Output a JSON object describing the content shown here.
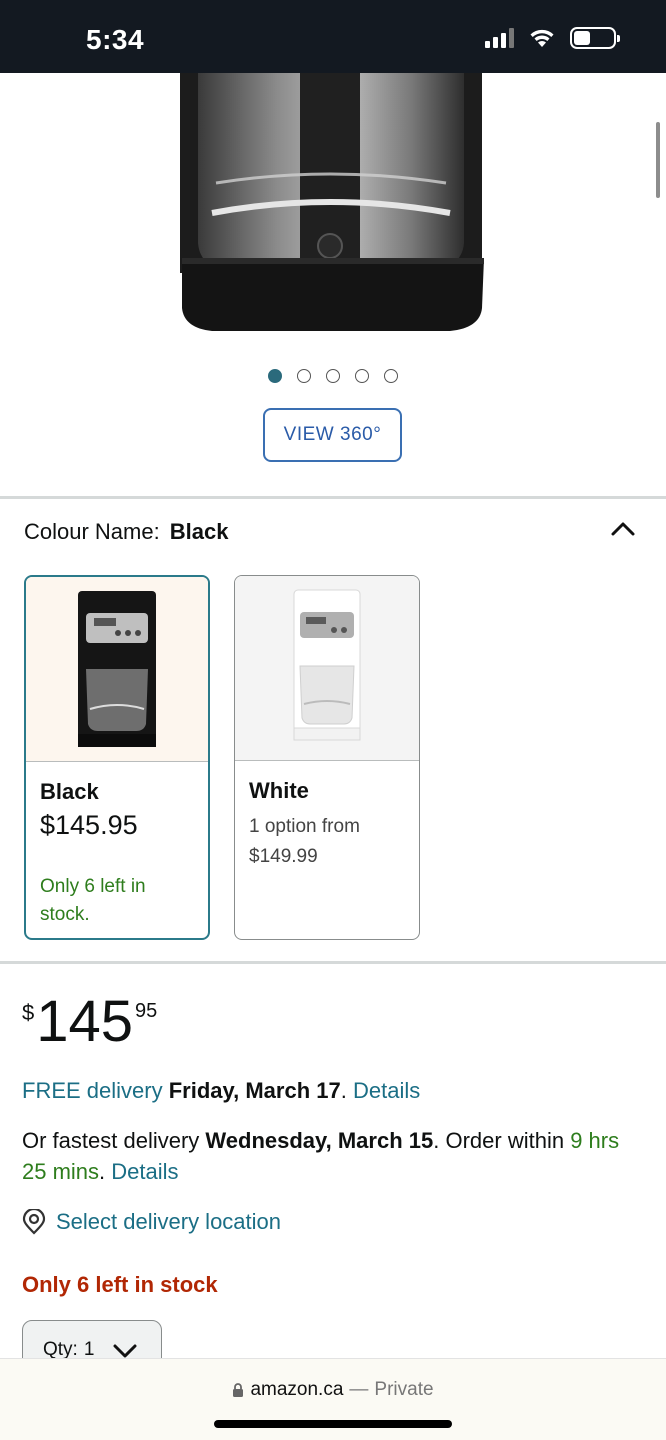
{
  "status_bar": {
    "time": "5:34"
  },
  "carousel": {
    "total_images": 5,
    "active_index": 0
  },
  "view360": {
    "label": "VIEW 360°"
  },
  "colour": {
    "label": "Colour Name:",
    "selected": "Black",
    "options": [
      {
        "name": "Black",
        "price": "$145.95",
        "stock": "Only 6 left in stock."
      },
      {
        "name": "White",
        "option_text": "1 option from",
        "price": "$149.99"
      }
    ]
  },
  "price": {
    "symbol": "$",
    "whole": "145",
    "cents": "95"
  },
  "delivery": {
    "free_prefix": "FREE delivery",
    "free_date": "Friday, March 17",
    "period": ".",
    "details": "Details",
    "fastest_prefix": "Or fastest delivery",
    "fastest_date": "Wednesday, March 15",
    "order_within_label": ". Order within",
    "order_within_time": "9 hrs 25 mins",
    "location": "Select delivery location"
  },
  "stock_alert": "Only 6 left in stock",
  "quantity": {
    "label": "Qty:",
    "value": "1"
  },
  "browser": {
    "domain": "amazon.ca",
    "separator": "—",
    "mode": "Private"
  },
  "colors": {
    "accent": "#1b6e85",
    "stock_green": "#2e7d1d",
    "alert": "#b12704",
    "status_bar": "#131921"
  }
}
